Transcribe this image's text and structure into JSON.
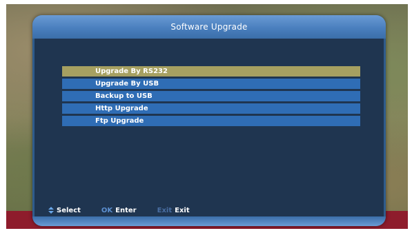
{
  "window": {
    "title": "Software Upgrade"
  },
  "menu": {
    "items": [
      {
        "label": "Upgrade By RS232",
        "selected": true
      },
      {
        "label": "Upgrade By USB",
        "selected": false
      },
      {
        "label": "Backup to USB",
        "selected": false
      },
      {
        "label": "Http Upgrade",
        "selected": false
      },
      {
        "label": "Ftp Upgrade",
        "selected": false
      }
    ]
  },
  "help": {
    "select": {
      "icon": "up-down-arrow-icon",
      "label": "Select"
    },
    "enter": {
      "key": "OK",
      "label": "Enter"
    },
    "exit": {
      "key": "Exit",
      "label": "Exit"
    }
  },
  "colors": {
    "selected": "#a6a061",
    "item": "#2f6db5",
    "panel": "#1f3550",
    "title_bar": "#4a7fbe",
    "bottom_band": "#8e1c2c"
  }
}
